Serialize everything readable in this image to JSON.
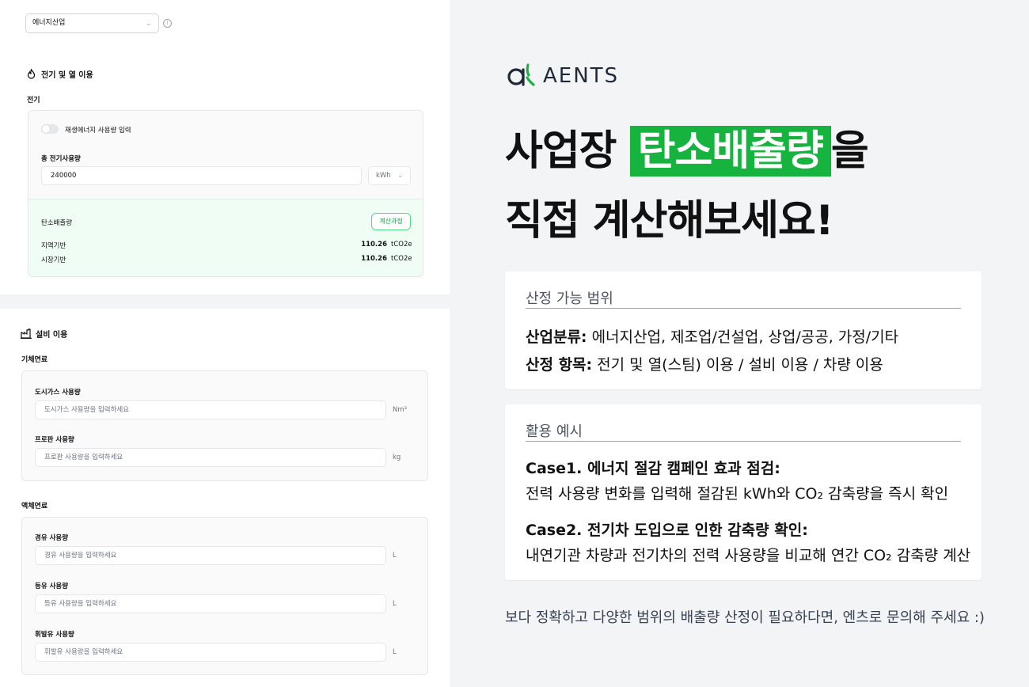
{
  "industry_select": {
    "value": "에너지산업"
  },
  "electric_section": {
    "title": "전기 및 열 이용",
    "subtitle": "전기",
    "renewable_toggle_label": "재생에너지 사용량 입력",
    "total_label": "총 전기사용량",
    "total_value": "240000",
    "unit": "kWh",
    "result": {
      "title": "탄소배출량",
      "calc_button": "계산과정",
      "rows": [
        {
          "label": "지역기반",
          "value": "110.26",
          "unit": "tCO2e"
        },
        {
          "label": "시장기반",
          "value": "110.26",
          "unit": "tCO2e"
        }
      ]
    }
  },
  "equipment_section": {
    "title": "설비 이용",
    "gas_group": {
      "label": "기체연료",
      "fields": [
        {
          "label": "도시가스 사용량",
          "placeholder": "도시가스 사용량을 입력하세요",
          "unit": "Nm³"
        },
        {
          "label": "프로판 사용량",
          "placeholder": "프로판 사용량을 입력하세요",
          "unit": "kg"
        }
      ]
    },
    "liquid_group": {
      "label": "액체연료",
      "fields": [
        {
          "label": "경유 사용량",
          "placeholder": "경유 사용량을 입력하세요",
          "unit": "L"
        },
        {
          "label": "등유 사용량",
          "placeholder": "등유 사용량을 입력하세요",
          "unit": "L"
        },
        {
          "label": "휘발유 사용량",
          "placeholder": "휘발유 사용량을 입력하세요",
          "unit": "L"
        }
      ]
    }
  },
  "promo": {
    "logo_text": "AENTS",
    "headline_line1_pre": "사업장 ",
    "headline_highlight": "탄소배출량",
    "headline_line1_post": "을",
    "headline_line2": "직접 계산해보세요!",
    "scope_box": {
      "title": "산정 가능 범위",
      "rows": [
        {
          "label": "산업분류:",
          "text": " 에너지산업, 제조업/건설업, 상업/공공, 가정/기타"
        },
        {
          "label": "산정 항목:",
          "text": " 전기 및 열(스팀) 이용 / 설비 이용 / 차량 이용"
        }
      ]
    },
    "example_box": {
      "title": "활용 예시",
      "cases": [
        {
          "heading": "Case1. 에너지 절감 캠페인 효과 점검:",
          "text": "전력 사용량 변화를 입력해 절감된 kWh와 CO₂ 감축량을 즉시 확인"
        },
        {
          "heading": "Case2. 전기차 도입으로 인한 감축량 확인:",
          "text": "내연기관 차량과 전기차의 전력 사용량을 비교해 연간 CO₂ 감축량 계산"
        }
      ]
    },
    "footer": "보다 정확하고 다양한 범위의 배출량 산정이 필요하다면, 엔츠로 문의해 주세요 :)"
  },
  "colors": {
    "accent_green": "#16b43f",
    "result_bg": "#f0fdf4",
    "button_green": "#16a34a"
  },
  "icons": {
    "flame": "flame-icon",
    "factory": "factory-icon",
    "info": "info-icon",
    "chevron": "chevron-down-icon"
  }
}
